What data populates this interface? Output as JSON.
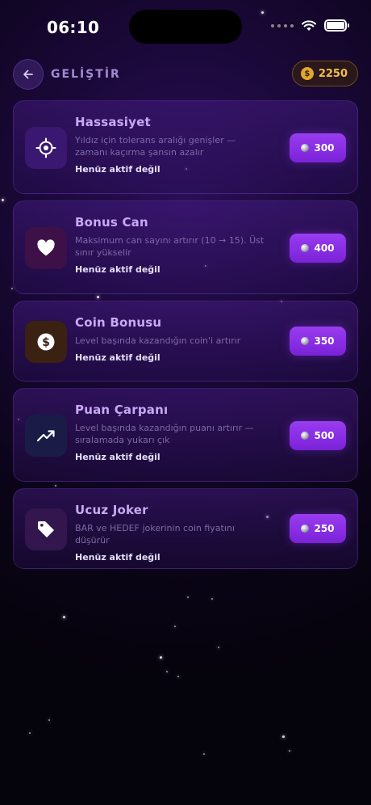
{
  "status_bar": {
    "time": "06:10"
  },
  "header": {
    "title": "GELİŞTİR",
    "coins": "2250"
  },
  "colors": {
    "accent": "#8a2be2",
    "gold": "#f0c04a"
  },
  "upgrades": [
    {
      "title": "Hassasiyet",
      "desc": "Yıldız için tolerans aralığı genişler — zamanı kaçırma şansın azalır",
      "status": "Henüz aktif değil",
      "price": "300",
      "icon": "target-icon"
    },
    {
      "title": "Bonus Can",
      "desc": "Maksimum can sayını artırır (10 → 15). Üst sınır yükselir",
      "status": "Henüz aktif değil",
      "price": "400",
      "icon": "heart-icon"
    },
    {
      "title": "Coin Bonusu",
      "desc": "Level başında kazandığın coin'i artırır",
      "status": "Henüz aktif değil",
      "price": "350",
      "icon": "dollar-coin-icon"
    },
    {
      "title": "Puan Çarpanı",
      "desc": "Level başında kazandığın puanı artırır — sıralamada yukarı çık",
      "status": "Henüz aktif değil",
      "price": "500",
      "icon": "trending-up-icon"
    },
    {
      "title": "Ucuz Joker",
      "desc": "BAR ve HEDEF jokerinin coin fiyatını düşürür",
      "status": "Henüz aktif değil",
      "price": "250",
      "icon": "tag-icon"
    }
  ]
}
